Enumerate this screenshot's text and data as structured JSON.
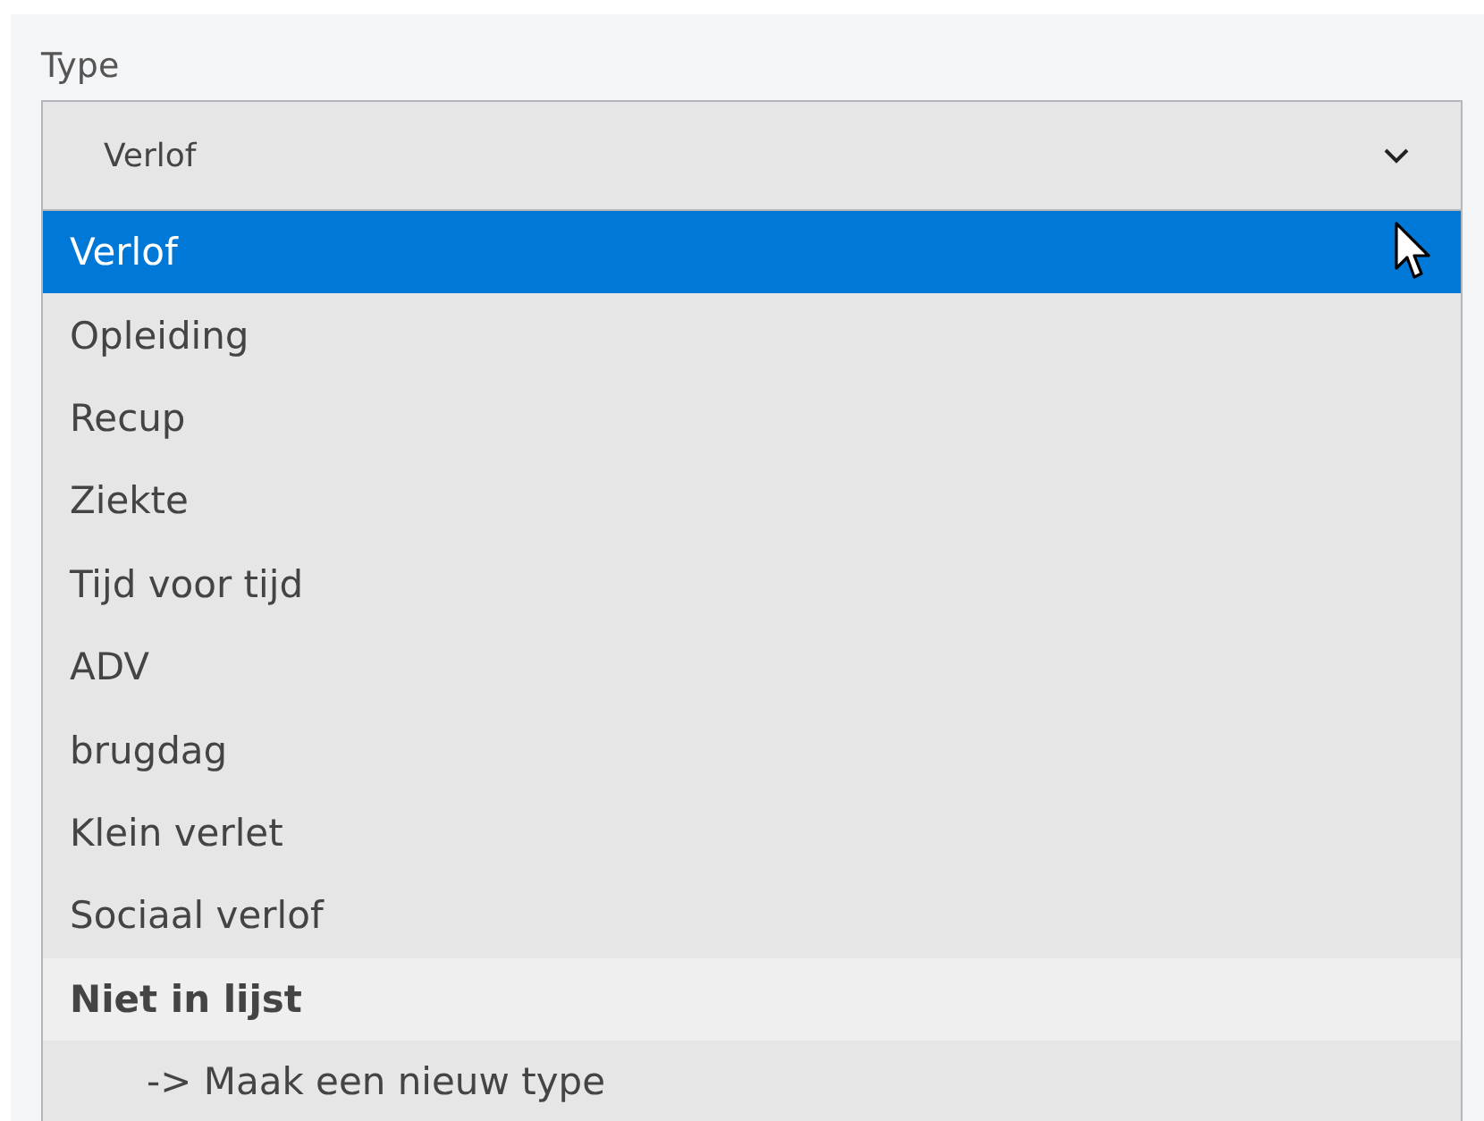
{
  "field": {
    "label": "Type",
    "value": "Verlof",
    "expanded": true
  },
  "options": [
    {
      "kind": "option",
      "label": "Verlof",
      "selected": true
    },
    {
      "kind": "option",
      "label": "Opleiding",
      "selected": false
    },
    {
      "kind": "option",
      "label": "Recup",
      "selected": false
    },
    {
      "kind": "option",
      "label": "Ziekte",
      "selected": false
    },
    {
      "kind": "option",
      "label": "Tijd voor tijd",
      "selected": false
    },
    {
      "kind": "option",
      "label": "ADV",
      "selected": false
    },
    {
      "kind": "option",
      "label": "brugdag",
      "selected": false
    },
    {
      "kind": "option",
      "label": "Klein verlet",
      "selected": false
    },
    {
      "kind": "option",
      "label": "Sociaal verlof",
      "selected": false
    },
    {
      "kind": "heading",
      "label": "Niet in lijst",
      "selected": false
    },
    {
      "kind": "action",
      "label": "-> Maak een nieuw type",
      "selected": false
    }
  ]
}
